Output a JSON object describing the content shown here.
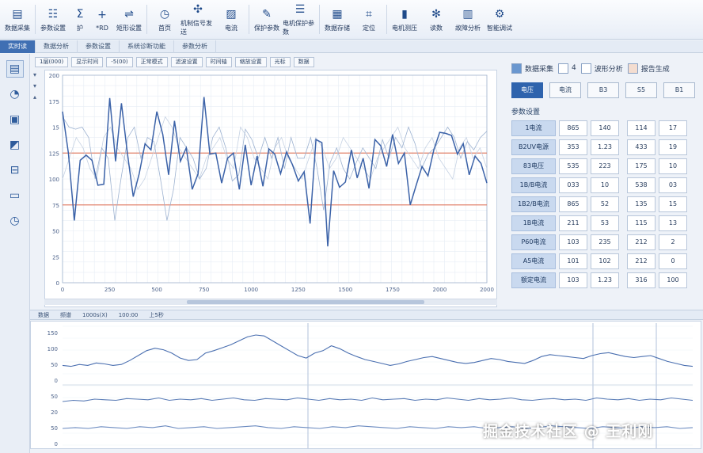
{
  "ribbon": {
    "items": [
      {
        "label": "数据采集",
        "icon": "document-icon"
      },
      {
        "label": "参数设置",
        "icon": "settings-list-icon"
      },
      {
        "label": "护",
        "icon": "sigma-icon"
      },
      {
        "label": "*RD",
        "icon": "plus-icon"
      },
      {
        "label": "矩形设置",
        "icon": "sliders-icon"
      },
      {
        "label": "首页",
        "icon": "clock-icon"
      },
      {
        "label": "机制信号发送",
        "icon": "fan-icon"
      },
      {
        "label": "电流",
        "icon": "image-icon"
      },
      {
        "label": "保护参数",
        "icon": "edit-icon"
      },
      {
        "label": "电机保护参数",
        "icon": "checklist-icon"
      },
      {
        "label": "数据存储",
        "icon": "grid-doc-icon"
      },
      {
        "label": "定位",
        "icon": "crop-icon"
      },
      {
        "label": "电机测压",
        "icon": "battery-icon"
      },
      {
        "label": "读数",
        "icon": "snowflake-icon"
      },
      {
        "label": "故障分析",
        "icon": "clipboard-icon"
      },
      {
        "label": "智能调试",
        "icon": "gear-icon"
      }
    ]
  },
  "tabs": [
    "实时读",
    "数据分析",
    "参数设置",
    "系统诊断功能",
    "参数分析"
  ],
  "toolbar": [
    "1层(000)",
    "显示时间",
    "-5(00)",
    "正常模式",
    "滤波设置",
    "时间轴",
    "缩放设置",
    "光标",
    "数据"
  ],
  "main_chart": {
    "y_ticks": [
      "200",
      "175",
      "15",
      "125",
      "100",
      "75",
      "50",
      "25",
      "0"
    ],
    "x_ticks": [
      "0",
      "250",
      "500",
      "750",
      "1000",
      "1250",
      "1500",
      "1750",
      "2000",
      "2000"
    ],
    "series": [
      {
        "name": "main",
        "color": "#3b62a8",
        "values": [
          165,
          125,
          60,
          118,
          123,
          118,
          94,
          95,
          178,
          117,
          173,
          125,
          83,
          105,
          134,
          128,
          165,
          143,
          104,
          156,
          117,
          130,
          90,
          105,
          179,
          124,
          125,
          96,
          120,
          125,
          90,
          133,
          94,
          122,
          93,
          129,
          124,
          105,
          126,
          114,
          98,
          107,
          57,
          138,
          135,
          35,
          108,
          92,
          97,
          128,
          101,
          120,
          91,
          138,
          132,
          112,
          143,
          115,
          125,
          75,
          94,
          112,
          103,
          128,
          145,
          144,
          142,
          124,
          134,
          104,
          122,
          115,
          96
        ]
      },
      {
        "name": "ref",
        "color": "#9eb3d1",
        "values": [
          160,
          150,
          148,
          150,
          140,
          100,
          130,
          120,
          60,
          102,
          140,
          150,
          120,
          140,
          136,
          100,
          60,
          90,
          140,
          130,
          120,
          100,
          110,
          140,
          150,
          130,
          98,
          104,
          148,
          138,
          120,
          140,
          120,
          140,
          110,
          140,
          120,
          120,
          140,
          110,
          70,
          116,
          130,
          110,
          100,
          116,
          130,
          120,
          110,
          138,
          120,
          140,
          130,
          150,
          134,
          110,
          124,
          130,
          140,
          150,
          140,
          120,
          136,
          128,
          140,
          146
        ]
      },
      {
        "name": "aux",
        "color": "#c6d2e3",
        "values": [
          100,
          120,
          140,
          130,
          110,
          100,
          140,
          150,
          130,
          120,
          110,
          90,
          100,
          120,
          140,
          160,
          150,
          130,
          120,
          110,
          100,
          120,
          130,
          140,
          120,
          110,
          150,
          140,
          120,
          110,
          100,
          130,
          140,
          120,
          110,
          100,
          120,
          140,
          130,
          110,
          120,
          140,
          130,
          120,
          110,
          100,
          120,
          130,
          140,
          150,
          130,
          120,
          110,
          130,
          140,
          120,
          110,
          100,
          130,
          140,
          120,
          130,
          110
        ]
      }
    ],
    "thresholds": [
      {
        "label": "upper",
        "value": 125,
        "color": "#e0806a"
      },
      {
        "label": "lower",
        "value": 75,
        "color": "#e0806a"
      }
    ]
  },
  "right_panel": {
    "legend": [
      {
        "label": "数据采集",
        "color": "#6a97cf"
      },
      {
        "label": "4",
        "color": "#ffffff"
      },
      {
        "label": "波形分析",
        "color": "#ffffff"
      },
      {
        "label": "报告生成",
        "color": "#f4ddd0"
      }
    ],
    "modes": [
      "电压",
      "电流",
      "B3",
      "S5",
      "B1"
    ],
    "param_title": "参数设置",
    "params": [
      {
        "name": "1电流",
        "v": [
          "865",
          "140",
          "114",
          "17"
        ]
      },
      {
        "name": "B2UV电源",
        "v": [
          "353",
          "1.23",
          "433",
          "19"
        ]
      },
      {
        "name": "83电压",
        "v": [
          "535",
          "223",
          "175",
          "10"
        ]
      },
      {
        "name": "1B/B电流",
        "v": [
          "033",
          "10",
          "538",
          "03"
        ]
      },
      {
        "name": "1B2/B电流",
        "v": [
          "865",
          "52",
          "135",
          "15"
        ]
      },
      {
        "name": "1B电流",
        "v": [
          "211",
          "53",
          "115",
          "13"
        ]
      },
      {
        "name": "P60电流",
        "v": [
          "103",
          "235",
          "212",
          "2"
        ]
      },
      {
        "name": "A5电流",
        "v": [
          "101",
          "102",
          "212",
          "0"
        ]
      },
      {
        "name": "额定电流",
        "v": [
          "103",
          "1.23",
          "316",
          "100"
        ]
      }
    ]
  },
  "bottom": {
    "header": [
      "数据",
      "频谱",
      "1000s(X)",
      "100:00",
      "上5秒"
    ],
    "y_ticks": [
      "150",
      "100",
      "50",
      "0",
      "50",
      "20",
      "50",
      "0"
    ],
    "series": [
      {
        "name": "wave1",
        "color": "#4a6fb0",
        "values": [
          30,
          28,
          32,
          30,
          35,
          33,
          30,
          32,
          40,
          50,
          60,
          65,
          62,
          55,
          45,
          40,
          42,
          55,
          60,
          66,
          72,
          80,
          88,
          92,
          90,
          80,
          70,
          60,
          50,
          45,
          55,
          60,
          70,
          64,
          55,
          48,
          42,
          38,
          34,
          30,
          33,
          38,
          42,
          46,
          48,
          44,
          40,
          36,
          34,
          36,
          40,
          44,
          42,
          38,
          36,
          34,
          40,
          48,
          52,
          50,
          48,
          46,
          44,
          50,
          54,
          56,
          52,
          48,
          46,
          48,
          50,
          44,
          38,
          34,
          30,
          28
        ]
      },
      {
        "name": "wave2",
        "color": "#5a7cb6",
        "values": [
          20,
          22,
          21,
          24,
          23,
          22,
          25,
          24,
          23,
          26,
          22,
          24,
          23,
          25,
          22,
          24,
          26,
          23,
          22,
          25,
          24,
          23,
          26,
          24,
          22,
          25,
          23,
          24,
          22,
          26,
          23,
          24,
          25,
          22,
          24,
          23,
          26,
          24,
          22,
          25,
          23,
          24,
          26,
          23,
          22,
          24,
          25,
          23,
          24,
          22,
          26,
          24,
          23,
          25,
          22,
          24,
          23,
          26,
          24,
          22
        ]
      },
      {
        "name": "wave3",
        "color": "#6b8bc0",
        "values": [
          10,
          11,
          10,
          12,
          11,
          10,
          12,
          11,
          13,
          10,
          11,
          12,
          10,
          11,
          12,
          13,
          11,
          10,
          12,
          11,
          10,
          12,
          11,
          13,
          12,
          11,
          10,
          12,
          11,
          10,
          12,
          11,
          12,
          10,
          11,
          12,
          10,
          11,
          13,
          12,
          11,
          10,
          12,
          11,
          10,
          12,
          11,
          12,
          10,
          11
        ]
      }
    ]
  },
  "watermark": "掘金技术社区 @ 王利刚"
}
